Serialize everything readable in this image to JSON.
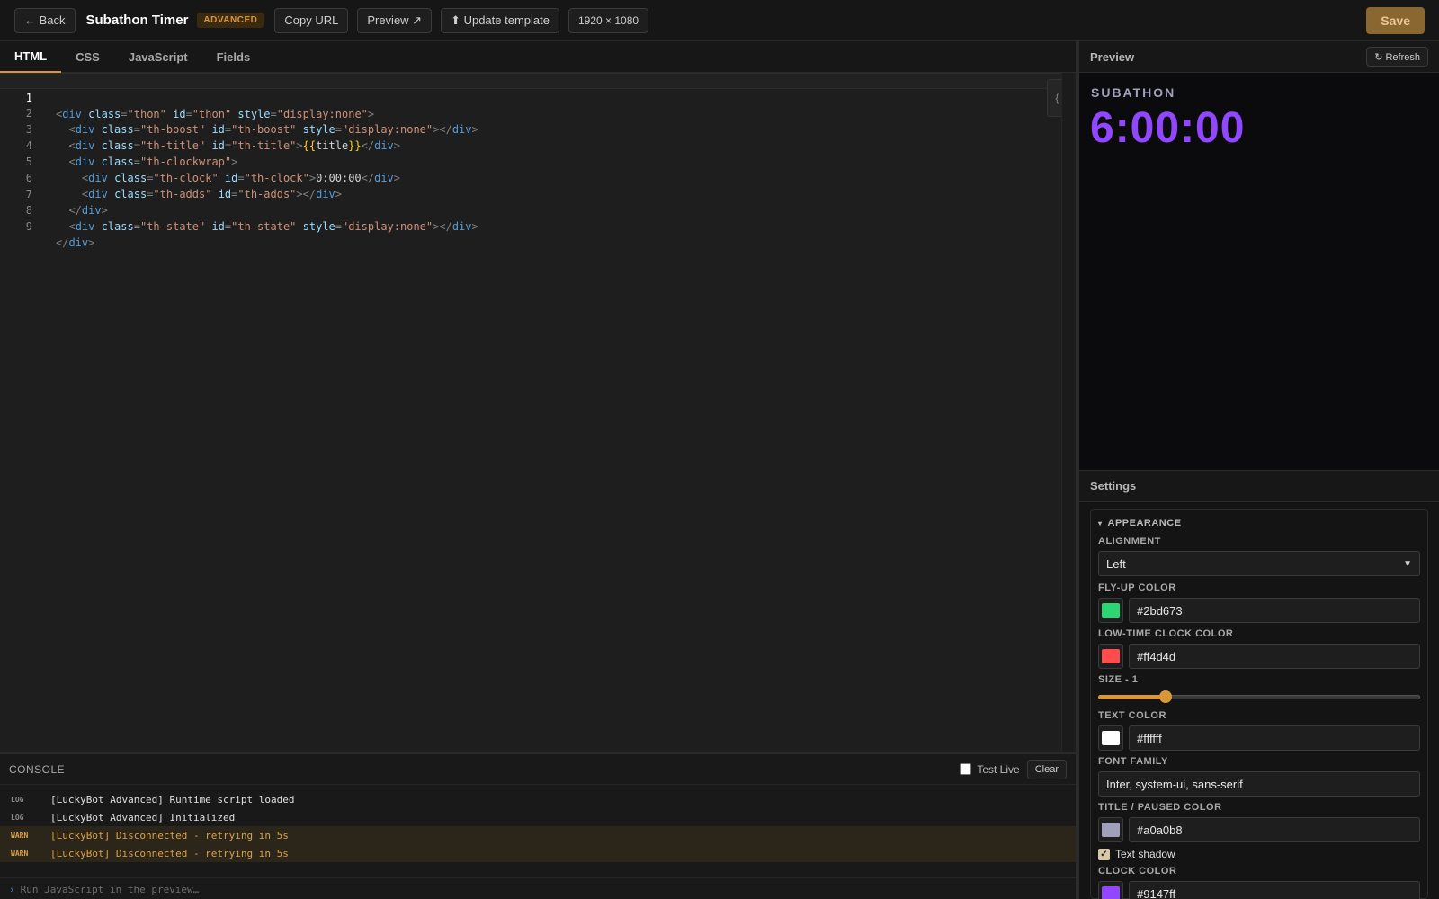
{
  "topbar": {
    "back_label": "← Back",
    "title": "Subathon Timer",
    "badge": "ADVANCED",
    "copy_url_label": "Copy URL",
    "preview_label": "Preview ↗",
    "update_template_label": "⬆ Update template",
    "resolution": "1920 × 1080",
    "save_label": "Save"
  },
  "tabs": [
    {
      "label": "HTML",
      "active": true
    },
    {
      "label": "CSS",
      "active": false
    },
    {
      "label": "JavaScript",
      "active": false
    },
    {
      "label": "Fields",
      "active": false
    }
  ],
  "editor": {
    "line_numbers": [
      "1",
      "2",
      "3",
      "4",
      "5",
      "6",
      "7",
      "8",
      "9"
    ],
    "format_icon": "braces-icon"
  },
  "console": {
    "title": "CONSOLE",
    "test_live_label": "Test Live",
    "test_live_checked": false,
    "clear_label": "Clear",
    "logs": [
      {
        "level": "LOG",
        "message": "[LuckyBot Advanced] Runtime script loaded"
      },
      {
        "level": "LOG",
        "message": "[LuckyBot Advanced] Initialized"
      },
      {
        "level": "WARN",
        "message": "[LuckyBot] Disconnected - retrying in 5s"
      },
      {
        "level": "WARN",
        "message": "[LuckyBot] Disconnected - retrying in 5s"
      }
    ],
    "input_placeholder": "Run JavaScript in the preview…"
  },
  "preview": {
    "title": "Preview",
    "refresh_label": "↻ Refresh",
    "overlay_title": "SUBATHON",
    "overlay_clock": "6:00:00"
  },
  "settings": {
    "title": "Settings",
    "group_label": "APPEARANCE",
    "alignment_label": "ALIGNMENT",
    "alignment_value": "Left",
    "flyup_label": "FLY-UP COLOR",
    "flyup_value": "#2bd673",
    "lowtime_label": "LOW-TIME CLOCK COLOR",
    "lowtime_value": "#ff4d4d",
    "size_label": "SIZE - 1",
    "size_fraction": 0.21,
    "textcolor_label": "TEXT COLOR",
    "textcolor_value": "#ffffff",
    "font_label": "FONT FAMILY",
    "font_value": "Inter, system-ui, sans-serif",
    "title_color_label": "TITLE / PAUSED COLOR",
    "title_color_value": "#a0a0b8",
    "shadow_label": "Text shadow",
    "shadow_checked": true,
    "clock_color_label": "CLOCK COLOR",
    "clock_color_value": "#9147ff"
  },
  "colors": {
    "accent": "#d9973a",
    "clock": "#9147ff",
    "title": "#a0a0b8"
  }
}
